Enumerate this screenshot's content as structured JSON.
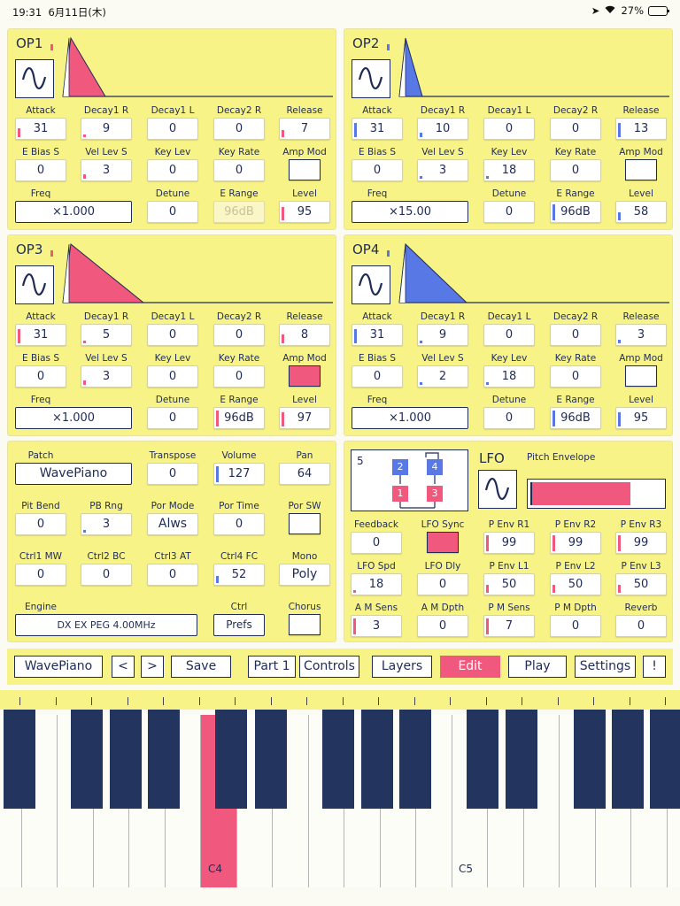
{
  "status": {
    "time": "19:31",
    "date": "6月11日(木)",
    "battery": "27%"
  },
  "ops": [
    {
      "title": "OP1",
      "color": "pink",
      "row1": [
        {
          "label": "Attack",
          "value": "31",
          "ind": 0.5
        },
        {
          "label": "Decay1 R",
          "value": "9",
          "ind": 0.15
        },
        {
          "label": "Decay1 L",
          "value": "0",
          "ind": 0
        },
        {
          "label": "Decay2 R",
          "value": "0",
          "ind": 0
        },
        {
          "label": "Release",
          "value": "7",
          "ind": 0.4
        }
      ],
      "row2": [
        {
          "label": "E Bias S",
          "value": "0",
          "ind": 0
        },
        {
          "label": "Vel Lev S",
          "value": "3",
          "ind": 0.25
        },
        {
          "label": "Key Lev",
          "value": "0",
          "ind": 0
        },
        {
          "label": "Key Rate",
          "value": "0",
          "ind": 0
        },
        {
          "label": "Amp Mod",
          "value": "",
          "check": false
        }
      ],
      "freq_label": "Freq",
      "freq": "×1.000",
      "row3": [
        {
          "label": "Detune",
          "value": "0",
          "ind": 0
        },
        {
          "label": "E Range",
          "value": "96dB",
          "dim": true
        },
        {
          "label": "Level",
          "value": "95",
          "ind": 0.75
        }
      ]
    },
    {
      "title": "OP2",
      "color": "blue",
      "row1": [
        {
          "label": "Attack",
          "value": "31",
          "ind": 0.8
        },
        {
          "label": "Decay1 R",
          "value": "10",
          "ind": 0.25
        },
        {
          "label": "Decay1 L",
          "value": "0",
          "ind": 0
        },
        {
          "label": "Decay2 R",
          "value": "0",
          "ind": 0
        },
        {
          "label": "Release",
          "value": "13",
          "ind": 0.8
        }
      ],
      "row2": [
        {
          "label": "E Bias S",
          "value": "0",
          "ind": 0
        },
        {
          "label": "Vel Lev S",
          "value": "3",
          "ind": 0.15
        },
        {
          "label": "Key Lev",
          "value": "18",
          "ind": 0.05
        },
        {
          "label": "Key Rate",
          "value": "0",
          "ind": 0
        },
        {
          "label": "Amp Mod",
          "value": "",
          "check": false
        }
      ],
      "freq_label": "Freq",
      "freq": "×15.00",
      "row3": [
        {
          "label": "Detune",
          "value": "0",
          "ind": 0
        },
        {
          "label": "E Range",
          "value": "96dB",
          "ind": 0.9
        },
        {
          "label": "Level",
          "value": "58",
          "ind": 0.45
        }
      ]
    },
    {
      "title": "OP3",
      "color": "pink",
      "row1": [
        {
          "label": "Attack",
          "value": "31",
          "ind": 0.8
        },
        {
          "label": "Decay1 R",
          "value": "5",
          "ind": 0.15
        },
        {
          "label": "Decay1 L",
          "value": "0",
          "ind": 0
        },
        {
          "label": "Decay2 R",
          "value": "0",
          "ind": 0
        },
        {
          "label": "Release",
          "value": "8",
          "ind": 0.5
        }
      ],
      "row2": [
        {
          "label": "E Bias S",
          "value": "0",
          "ind": 0
        },
        {
          "label": "Vel Lev S",
          "value": "3",
          "ind": 0.25
        },
        {
          "label": "Key Lev",
          "value": "0",
          "ind": 0
        },
        {
          "label": "Key Rate",
          "value": "0",
          "ind": 0
        },
        {
          "label": "Amp Mod",
          "value": "",
          "check": true
        }
      ],
      "freq_label": "Freq",
      "freq": "×1.000",
      "row3": [
        {
          "label": "Detune",
          "value": "0",
          "ind": 0
        },
        {
          "label": "E Range",
          "value": "96dB",
          "ind": 0.9
        },
        {
          "label": "Level",
          "value": "97",
          "ind": 0.8
        }
      ]
    },
    {
      "title": "OP4",
      "color": "blue",
      "row1": [
        {
          "label": "Attack",
          "value": "31",
          "ind": 0.8
        },
        {
          "label": "Decay1 R",
          "value": "9",
          "ind": 0.15
        },
        {
          "label": "Decay1 L",
          "value": "0",
          "ind": 0
        },
        {
          "label": "Decay2 R",
          "value": "0",
          "ind": 0
        },
        {
          "label": "Release",
          "value": "3",
          "ind": 0.2
        }
      ],
      "row2": [
        {
          "label": "E Bias S",
          "value": "0",
          "ind": 0
        },
        {
          "label": "Vel Lev S",
          "value": "2",
          "ind": 0.15
        },
        {
          "label": "Key Lev",
          "value": "18",
          "ind": 0.05
        },
        {
          "label": "Key Rate",
          "value": "0",
          "ind": 0
        },
        {
          "label": "Amp Mod",
          "value": "",
          "check": false
        }
      ],
      "freq_label": "Freq",
      "freq": "×1.000",
      "row3": [
        {
          "label": "Detune",
          "value": "0",
          "ind": 0
        },
        {
          "label": "E Range",
          "value": "96dB",
          "ind": 0.9
        },
        {
          "label": "Level",
          "value": "95",
          "ind": 0.8
        }
      ]
    }
  ],
  "patch": {
    "patch_label": "Patch",
    "patch": "WavePiano",
    "transpose_label": "Transpose",
    "transpose": "0",
    "volume_label": "Volume",
    "volume": "127",
    "pan_label": "Pan",
    "pan": "64",
    "r2": [
      {
        "label": "Pit Bend",
        "value": "0"
      },
      {
        "label": "PB Rng",
        "value": "3",
        "ind": 0.15
      },
      {
        "label": "Por Mode",
        "value": "Alws"
      },
      {
        "label": "Por Time",
        "value": "0"
      },
      {
        "label": "Por SW",
        "check": false
      }
    ],
    "r3": [
      {
        "label": "Ctrl1 MW",
        "value": "0"
      },
      {
        "label": "Ctrl2 BC",
        "value": "0"
      },
      {
        "label": "Ctrl3 AT",
        "value": "0"
      },
      {
        "label": "Ctrl4 FC",
        "value": "52",
        "ind": 0.4
      },
      {
        "label": "Mono",
        "value": "Poly"
      }
    ],
    "engine_label": "Engine",
    "engine": "DX EX PEG 4.00MHz",
    "ctrl_label": "Ctrl",
    "ctrl": "Prefs",
    "chorus_label": "Chorus"
  },
  "lfo": {
    "algorithm": "5",
    "ops_top": [
      "2",
      "4"
    ],
    "ops_bottom": [
      "1",
      "3"
    ],
    "lfo_title": "LFO",
    "pitch_env_label": "Pitch Envelope",
    "r1": [
      {
        "label": "Feedback",
        "value": "0"
      },
      {
        "label": "LFO Sync",
        "check": true
      },
      {
        "label": "P Env R1",
        "value": "99",
        "ind": 0.9
      },
      {
        "label": "P Env R2",
        "value": "99",
        "ind": 0.9
      },
      {
        "label": "P Env R3",
        "value": "99",
        "ind": 0.9
      }
    ],
    "r2": [
      {
        "label": "LFO Spd",
        "value": "18",
        "ind": 0.15
      },
      {
        "label": "LFO Dly",
        "value": "0"
      },
      {
        "label": "P Env L1",
        "value": "50",
        "ind": 0.45
      },
      {
        "label": "P Env L2",
        "value": "50",
        "ind": 0.45
      },
      {
        "label": "P Env L3",
        "value": "50",
        "ind": 0.45
      }
    ],
    "r3": [
      {
        "label": "A M Sens",
        "value": "3",
        "ind": 0.9
      },
      {
        "label": "A M Dpth",
        "value": "0"
      },
      {
        "label": "P M Sens",
        "value": "7",
        "ind": 0.9
      },
      {
        "label": "P M Dpth",
        "value": "0"
      },
      {
        "label": "Reverb",
        "value": "0"
      }
    ]
  },
  "toolbar": {
    "patch": "WavePiano",
    "prev": "<",
    "next": ">",
    "save": "Save",
    "part": "Part 1",
    "controls": "Controls",
    "layers": "Layers",
    "edit": "Edit",
    "play": "Play",
    "settings": "Settings",
    "info": "!"
  },
  "keyboard": {
    "c4": "C4",
    "c5": "C5",
    "highlighted": "C4"
  },
  "colors": {
    "panel": "#f8f387",
    "pink": "#f0587e",
    "blue": "#5878e6",
    "navy": "#1f2b57",
    "black_key": "#23355f"
  }
}
